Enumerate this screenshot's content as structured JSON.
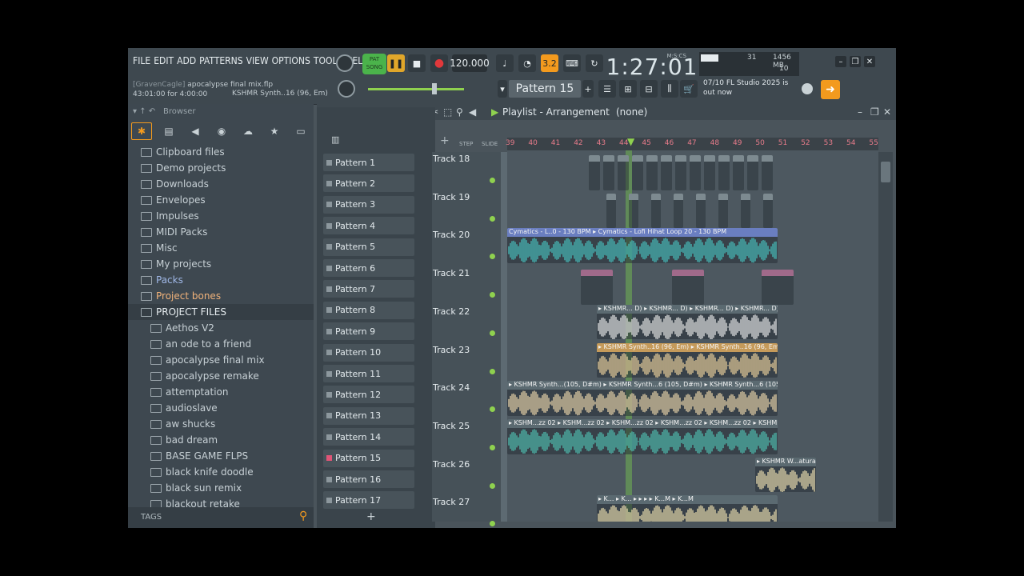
{
  "menu": [
    "FILE",
    "EDIT",
    "ADD",
    "PATTERNS",
    "VIEW",
    "OPTIONS",
    "TOOLS",
    "HELP"
  ],
  "project": {
    "user": "[GravenCagle]",
    "file": "apocalypse final mix.flp",
    "time": "43:01:00 for 4:00:00",
    "hint": "KSHMR Synth..16 (96, Em)"
  },
  "transport": {
    "song_label": "SONG",
    "bpm": "120.000",
    "clock": "1:27:01",
    "clock_unit": "M:S:CS",
    "snap": "3.2"
  },
  "monitor": {
    "cpu": "31",
    "ram": "1456 MB",
    "poly": "10"
  },
  "pattern_selector": "Pattern 15",
  "news": {
    "date": "07/10",
    "text": "FL Studio 2025 is out now"
  },
  "browser": {
    "title": "Browser",
    "items": [
      {
        "label": "Clipboard files",
        "indent": 0,
        "color": "#c7d0d5"
      },
      {
        "label": "Demo projects",
        "indent": 0,
        "color": "#c7d0d5"
      },
      {
        "label": "Downloads",
        "indent": 0,
        "color": "#c7d0d5"
      },
      {
        "label": "Envelopes",
        "indent": 0,
        "color": "#c7d0d5"
      },
      {
        "label": "Impulses",
        "indent": 0,
        "color": "#c7d0d5"
      },
      {
        "label": "MIDI Packs",
        "indent": 0,
        "color": "#c7d0d5"
      },
      {
        "label": "Misc",
        "indent": 0,
        "color": "#c7d0d5"
      },
      {
        "label": "My projects",
        "indent": 0,
        "color": "#c7d0d5"
      },
      {
        "label": "Packs",
        "indent": 0,
        "color": "#9fb7e6"
      },
      {
        "label": "Project bones",
        "indent": 0,
        "color": "#f0b27a"
      },
      {
        "label": "PROJECT FILES",
        "indent": 0,
        "color": "#e6ecef"
      },
      {
        "label": "Aethos V2",
        "indent": 1,
        "color": "#c7d0d5"
      },
      {
        "label": "an ode to a friend",
        "indent": 1,
        "color": "#c7d0d5"
      },
      {
        "label": "apocalypse final mix",
        "indent": 1,
        "color": "#c7d0d5"
      },
      {
        "label": "apocalypse remake",
        "indent": 1,
        "color": "#c7d0d5"
      },
      {
        "label": "attemptation",
        "indent": 1,
        "color": "#c7d0d5"
      },
      {
        "label": "audioslave",
        "indent": 1,
        "color": "#c7d0d5"
      },
      {
        "label": "aw shucks",
        "indent": 1,
        "color": "#c7d0d5"
      },
      {
        "label": "bad dream",
        "indent": 1,
        "color": "#c7d0d5"
      },
      {
        "label": "BASE GAME FLPS",
        "indent": 1,
        "color": "#c7d0d5"
      },
      {
        "label": "black knife doodle",
        "indent": 1,
        "color": "#c7d0d5"
      },
      {
        "label": "black sun remix",
        "indent": 1,
        "color": "#c7d0d5"
      },
      {
        "label": "blackout retake",
        "indent": 1,
        "color": "#c7d0d5"
      }
    ],
    "tags_label": "TAGS"
  },
  "patterns": [
    "Pattern 1",
    "Pattern 2",
    "Pattern 3",
    "Pattern 4",
    "Pattern 5",
    "Pattern 6",
    "Pattern 7",
    "Pattern 8",
    "Pattern 9",
    "Pattern 10",
    "Pattern 11",
    "Pattern 12",
    "Pattern 13",
    "Pattern 14",
    "Pattern 15",
    "Pattern 16",
    "Pattern 17"
  ],
  "playlist": {
    "title": "Playlist - Arrangement",
    "selection": "(none)",
    "step_label": "STEP",
    "slide_label": "SLIDE",
    "ruler": [
      "39",
      "40",
      "41",
      "42",
      "43",
      "44",
      "45",
      "46",
      "47",
      "48",
      "49",
      "50",
      "51",
      "52",
      "53",
      "54",
      "55"
    ],
    "tracks": [
      "Track 18",
      "Track 19",
      "Track 20",
      "Track 21",
      "Track 22",
      "Track 23",
      "Track 24",
      "Track 25",
      "Track 26",
      "Track 27"
    ],
    "clips": [
      {
        "track": 2,
        "label": "Cymatics - L..0 - 130 BPM ▸ Cymatics - Lofi Hihat Loop 20 - 130 BPM",
        "color": "#6a7ec0",
        "wave": "#48c6c2"
      },
      {
        "track": 4,
        "label": "▸ KSHMR... D) ▸ KSHMR... D) ▸ KSHMR... D) ▸ KSHMR... D)",
        "color": "#5b6a71",
        "wave": "#f0f0f0"
      },
      {
        "track": 5,
        "label": "▸ KSHMR Synth..16 (96, Em) ▸ KSHMR Synth..16 (96, Em)",
        "color": "#c59a5a",
        "wave": "#f5d9a0"
      },
      {
        "track": 6,
        "label": "▸ KSHMR Synth...(105, D#m) ▸ KSHMR Synth...6 (105, D#m) ▸ KSHMR Synth...6 (105, D#m)",
        "color": "#5b6a71",
        "wave": "#f2dcae"
      },
      {
        "track": 7,
        "label": "▸ KSHM...zz 02 ▸ KSHM...zz 02 ▸ KSHM...zz 02 ▸ KSHM...zz 02 ▸ KSHM...zz 02 ▸ KSHM...zz 02",
        "color": "#5b6a71",
        "wave": "#4fc4b5"
      },
      {
        "track": 8,
        "label": "▸ KSHMR W...atural",
        "color": "#5b6a71",
        "wave": "#f5e6b4"
      },
      {
        "track": 9,
        "label": "▸ K... ▸ K... ▸ ▸ ▸ ▸ K...M ▸ K...M",
        "color": "#5b6a71",
        "wave": "#f5e6b4"
      }
    ]
  }
}
